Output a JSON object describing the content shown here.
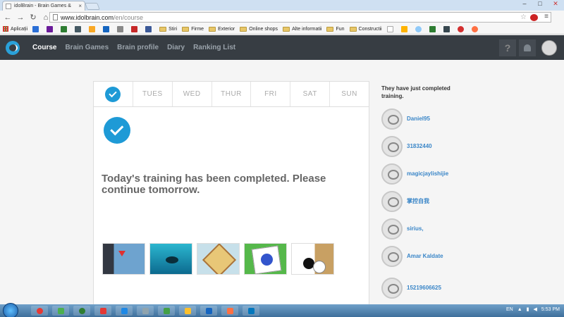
{
  "browser": {
    "tab_title": "idolBrain - Brain Games &",
    "url_host": "www.idolbrain.com",
    "url_path": "/en/course",
    "bookmarks": [
      {
        "label": "Aplicații"
      },
      {
        "label": ""
      },
      {
        "label": ""
      },
      {
        "label": ""
      },
      {
        "label": ""
      },
      {
        "label": ""
      },
      {
        "label": ""
      },
      {
        "label": ""
      },
      {
        "label": ""
      },
      {
        "label": ""
      },
      {
        "label": "Stiri"
      },
      {
        "label": "Firme"
      },
      {
        "label": "Exterior"
      },
      {
        "label": "Online shops"
      },
      {
        "label": "Alte informatii"
      },
      {
        "label": "Fun"
      },
      {
        "label": "Constructii"
      }
    ]
  },
  "nav": {
    "items": [
      "Course",
      "Brain Games",
      "Brain profile",
      "Diary",
      "Ranking List"
    ],
    "help": "?"
  },
  "week": {
    "days": [
      "",
      "TUES",
      "WED",
      "THUR",
      "FRI",
      "SAT",
      "SUN"
    ]
  },
  "main": {
    "message": "Today's training has been completed. Please continue tomorrow."
  },
  "sidebar": {
    "title": "They have just completed training.",
    "users": [
      "Daniel95",
      "31832440",
      "magicjaylishijie",
      "掌控自我",
      "sirius,",
      "Amar Kaldate",
      "15219606625"
    ]
  },
  "taskbar": {
    "lang": "EN",
    "time": "5:53 PM"
  }
}
